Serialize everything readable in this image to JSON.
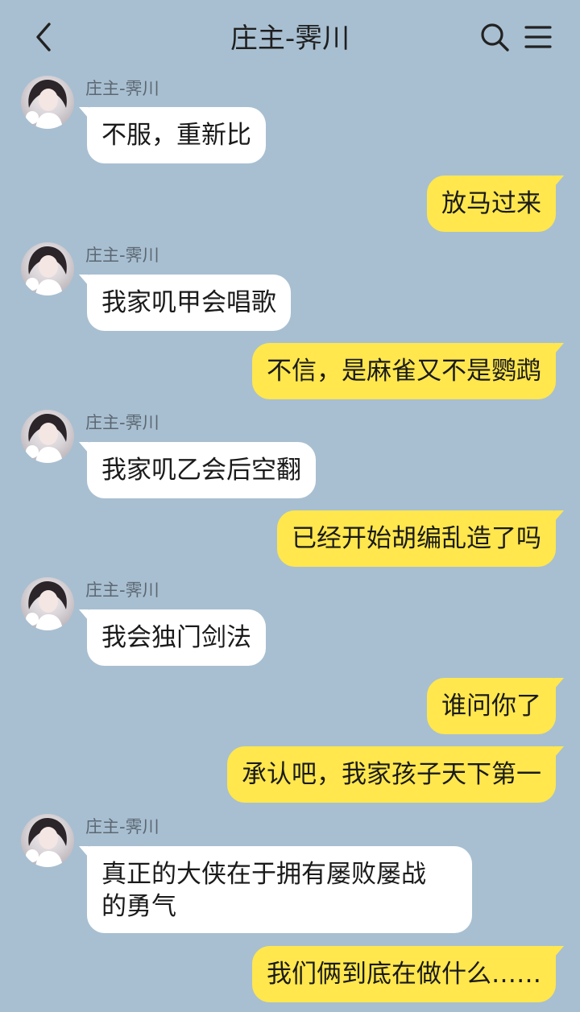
{
  "header": {
    "title": "庄主-霁川",
    "back_icon": "chevron-left-icon",
    "search_icon": "search-icon",
    "menu_icon": "menu-icon"
  },
  "messages": [
    {
      "side": "in",
      "sender": "庄主-霁川",
      "text": "不服，重新比"
    },
    {
      "side": "out",
      "text": "放马过来"
    },
    {
      "side": "in",
      "sender": "庄主-霁川",
      "text": "我家叽甲会唱歌"
    },
    {
      "side": "out",
      "text": "不信，是麻雀又不是鹦鹉"
    },
    {
      "side": "in",
      "sender": "庄主-霁川",
      "text": "我家叽乙会后空翻"
    },
    {
      "side": "out",
      "text": "已经开始胡编乱造了吗"
    },
    {
      "side": "in",
      "sender": "庄主-霁川",
      "text": "我会独门剑法"
    },
    {
      "side": "out",
      "text": "谁问你了"
    },
    {
      "side": "out",
      "text": "承认吧，我家孩子天下第一"
    },
    {
      "side": "in",
      "sender": "庄主-霁川",
      "text": "真正的大侠在于拥有屡败屡战\n的勇气"
    },
    {
      "side": "out",
      "text": "我们俩到底在做什么……"
    }
  ],
  "colors": {
    "background": "#a8bfd1",
    "incoming_bubble": "#ffffff",
    "outgoing_bubble": "#ffe74d"
  }
}
